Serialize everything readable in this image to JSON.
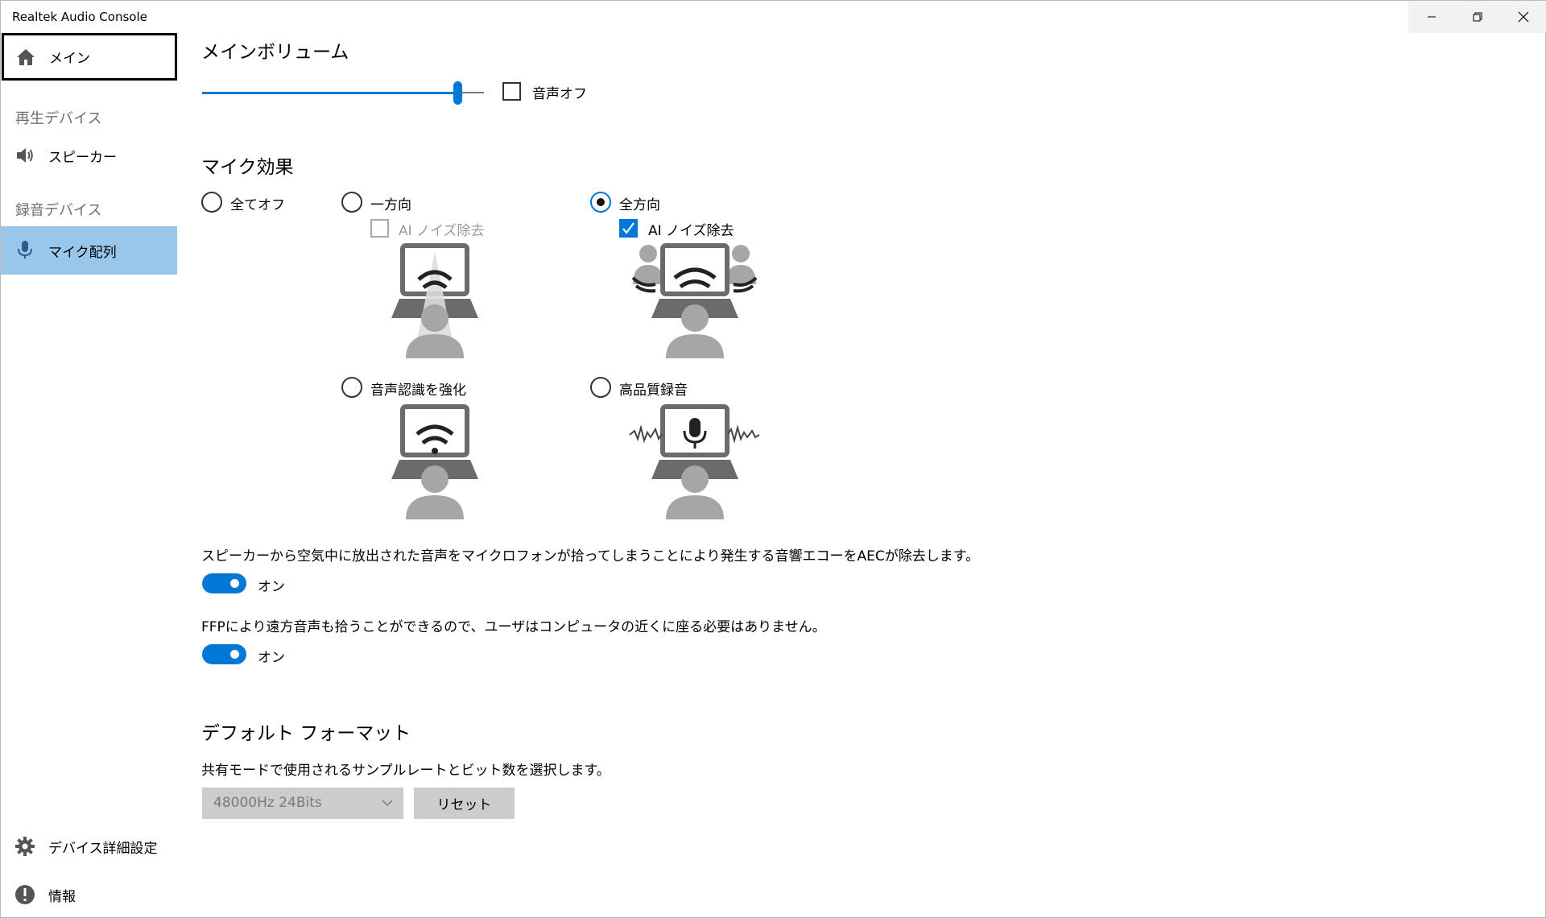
{
  "window": {
    "title": "Realtek Audio Console",
    "minimize_icon": "minimize-icon",
    "maximize_icon": "restore-icon",
    "close_icon": "close-icon"
  },
  "sidebar": {
    "main": {
      "label": "メイン",
      "icon": "home-icon"
    },
    "playback_section": "再生デバイス",
    "speaker": {
      "label": "スピーカー",
      "icon": "speaker-icon"
    },
    "recording_section": "録音デバイス",
    "mic_array": {
      "label": "マイク配列",
      "icon": "microphone-icon"
    },
    "advanced": {
      "label": "デバイス詳細設定",
      "icon": "gear-icon"
    },
    "info": {
      "label": "情報",
      "icon": "info-icon"
    }
  },
  "main_volume": {
    "title": "メインボリューム",
    "level_percent": 91,
    "mute_label": "音声オフ",
    "muted": false
  },
  "mic_effects": {
    "title": "マイク効果",
    "options": [
      {
        "id": "all_off",
        "label": "全てオフ",
        "selected": false
      },
      {
        "id": "directional",
        "label": "一方向",
        "selected": false
      },
      {
        "id": "omni",
        "label": "全方向",
        "selected": true
      },
      {
        "id": "speech",
        "label": "音声認識を強化",
        "selected": false
      },
      {
        "id": "hq",
        "label": "高品質録音",
        "selected": false
      }
    ],
    "directional_ai_noise": {
      "label": "AI ノイズ除去",
      "checked": false,
      "disabled": true
    },
    "omni_ai_noise": {
      "label": "AI ノイズ除去",
      "checked": true,
      "disabled": false
    }
  },
  "aec": {
    "description": "スピーカーから空気中に放出された音声をマイクロフォンが拾ってしまうことにより発生する音響エコーをAECが除去します。",
    "state_label": "オン",
    "on": true
  },
  "ffp": {
    "description": "FFPにより遠方音声も拾うことができるので、ユーザはコンピュータの近くに座る必要はありません。",
    "state_label": "オン",
    "on": true
  },
  "default_format": {
    "title": "デフォルト フォーマット",
    "description": "共有モードで使用されるサンプルレートとビット数を選択します。",
    "selected": "48000Hz 24Bits",
    "reset_label": "リセット"
  },
  "colors": {
    "accent": "#0078d7",
    "selected_nav": "#99c7ec",
    "illustration_dark": "#6b6b6b",
    "illustration_light": "#a6a6a6"
  }
}
